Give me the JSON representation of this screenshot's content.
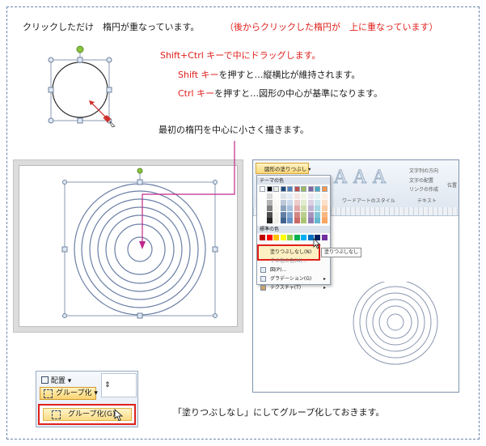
{
  "title_line": "クリックしただけ　楕円が重なっています。",
  "title_note": "（後からクリックした楕円が　上に重なっています）",
  "instructions": {
    "line1": "Shift+Ctrl キーで中にドラッグします。",
    "line2_key": "Shift キー",
    "line2_rest": "を押すと…縦横比が維持されます。",
    "line3_key": "Ctrl キー",
    "line3_rest": "を押すと…図形の中心が基準になります。"
  },
  "draw_smaller": "最初の楕円を中心に小さく描きます。",
  "office_menu": {
    "fill_button": "図形の塗りつぶし ▾",
    "theme_colors": "テーマの色",
    "standard_colors": "標準の色",
    "no_fill": "塗りつぶしなし(N)",
    "other_colors": "その他の色(M)...",
    "picture": "図(P)...",
    "gradient": "グラデーション(G)",
    "texture": "テクスチャ(T)",
    "tooltip": "塗りつぶしなし",
    "ribbon_wordart": "ワードアートのスタイル",
    "ribbon_text": "テキスト",
    "ribbon_text_dir": "文字列の方向",
    "ribbon_text_align": "文字の配置",
    "ribbon_link": "リンクの作成",
    "ribbon_position": "位置"
  },
  "group_panel": {
    "arrange": "配置",
    "group_btn": "グループ化",
    "group_menu_item": "グループ化(G)"
  },
  "footer_note": "「塗りつぶしなし」にしてグループ化しておきます。",
  "colors": {
    "accent_red": "#e0201c",
    "shape_outline": "#6b7fa6",
    "handle_green": "#8ac43f"
  }
}
